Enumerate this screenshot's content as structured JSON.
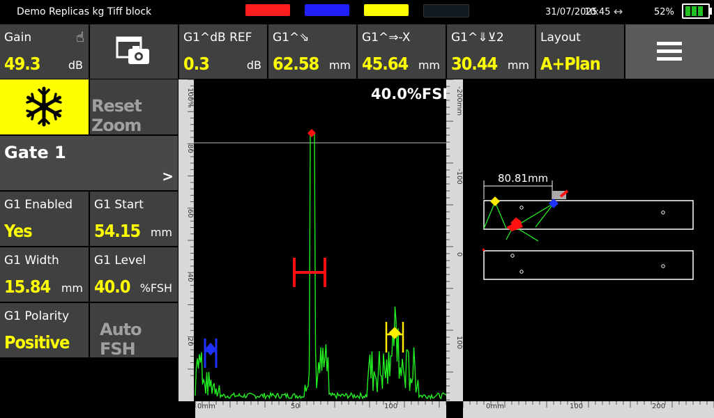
{
  "status": {
    "title": "Demo Replicas kg Tiff block",
    "date": "31/07/2025",
    "time": "10:45",
    "link_icon": "↔",
    "battery_pct": "52%",
    "color_pills": [
      "#ff1e1e",
      "#2020ff",
      "#ffff00",
      "#101820"
    ]
  },
  "tiles": {
    "gain": {
      "label": "Gain",
      "value": "49.3",
      "unit": "dB"
    },
    "ref": {
      "label": "G1^dB REF",
      "value": "0.3",
      "unit": "dB"
    },
    "soundpath": {
      "label": "G1^⇘",
      "value": "62.58",
      "unit": "mm"
    },
    "surface": {
      "label": "G1^⇒-X",
      "value": "45.64",
      "unit": "mm"
    },
    "depth": {
      "label": "G1^⇓⊻2",
      "value": "30.44",
      "unit": "mm"
    },
    "layout": {
      "label": "Layout",
      "value": "A+Plan"
    }
  },
  "side": {
    "reset_zoom": "Reset Zoom",
    "gate_title": "Gate 1",
    "gate_arrow": ">",
    "g1_enabled": {
      "label": "G1 Enabled",
      "value": "Yes"
    },
    "g1_start": {
      "label": "G1 Start",
      "value": "54.15",
      "unit": "mm"
    },
    "g1_width": {
      "label": "G1 Width",
      "value": "15.84",
      "unit": "mm"
    },
    "g1_level": {
      "label": "G1 Level",
      "value": "40.0",
      "unit": "%FSH"
    },
    "g1_polarity": {
      "label": "G1 Polarity",
      "value": "Positive"
    },
    "auto_fsh": "Auto FSH"
  },
  "ascan": {
    "fsh_readout": "40.0%FSH",
    "y_ticks": [
      "100%",
      "80",
      "60",
      "40",
      "20"
    ],
    "x_ticks": [
      "0mm",
      "50",
      "100"
    ],
    "right_ticks": [
      "-200mm",
      "-100",
      "0",
      "100"
    ]
  },
  "plan": {
    "measure": "80.81mm",
    "x_ticks": [
      "0mm",
      "100",
      "200"
    ]
  }
}
